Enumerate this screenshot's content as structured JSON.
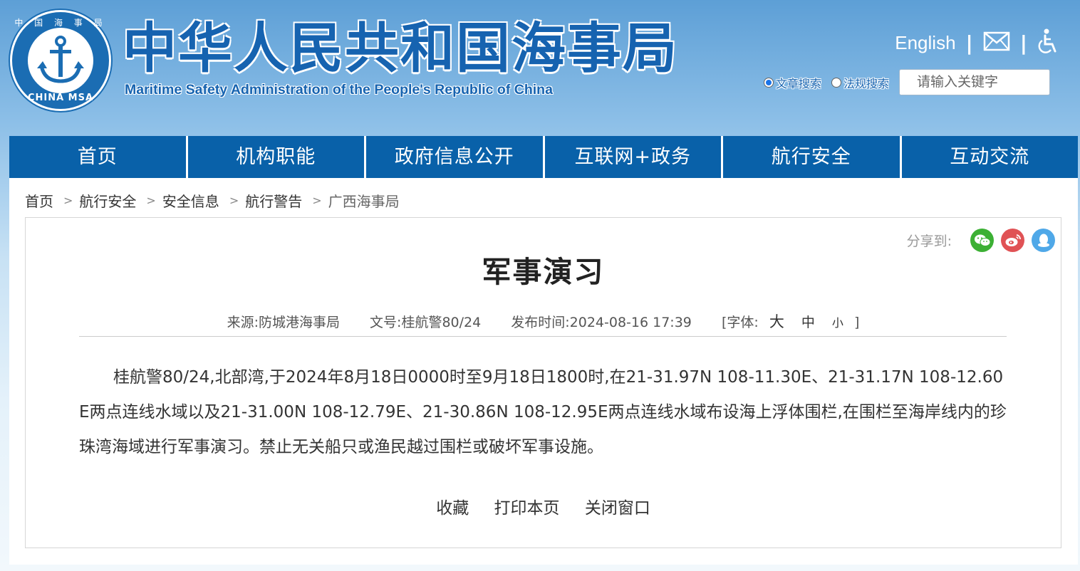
{
  "header": {
    "logo_top_text": "中 国 海 事 局",
    "logo_bottom_text": "CHINA MSA",
    "title": "中华人民共和国海事局",
    "subtitle": "Maritime Safety Administration of the People's Republic of China",
    "english_link": "English",
    "search_options": [
      "文章搜索",
      "法规搜索"
    ],
    "search_selected": "文章搜索",
    "search_placeholder": "请输入关键字"
  },
  "nav": {
    "items": [
      "首页",
      "机构职能",
      "政府信息公开",
      "互联网+政务",
      "航行安全",
      "互动交流"
    ]
  },
  "breadcrumb": {
    "items": [
      "首页",
      "航行安全",
      "安全信息",
      "航行警告",
      "广西海事局"
    ],
    "separator": ">"
  },
  "article": {
    "share_label": "分享到:",
    "share_targets": [
      "wechat-icon",
      "weibo-icon",
      "qq-icon"
    ],
    "title": "军事演习",
    "source": "来源:防城港海事局",
    "doc_no": "文号:桂航警80/24",
    "publish_time": "发布时间:2024-08-16 17:39",
    "font_label": "[字体:",
    "font_large": "大",
    "font_medium": "中",
    "font_small": "小",
    "font_close": "]",
    "body": "桂航警80/24,北部湾,于2024年8月18日0000时至9月18日1800时,在21-31.97N 108-11.30E、21-31.17N 108-12.60E两点连线水域以及21-31.00N 108-12.79E、21-30.86N 108-12.95E两点连线水域布设海上浮体围栏,在围栏至海岸线内的珍珠湾海域进行军事演习。禁止无关船只或渔民越过围栏或破坏军事设施。",
    "actions": [
      "收藏",
      "打印本页",
      "关闭窗口"
    ]
  },
  "colors": {
    "brand_blue": "#1663b0",
    "nav_blue": "#0961a9",
    "wechat": "#3cb034",
    "weibo": "#e05255",
    "qq": "#4fa8e8"
  }
}
